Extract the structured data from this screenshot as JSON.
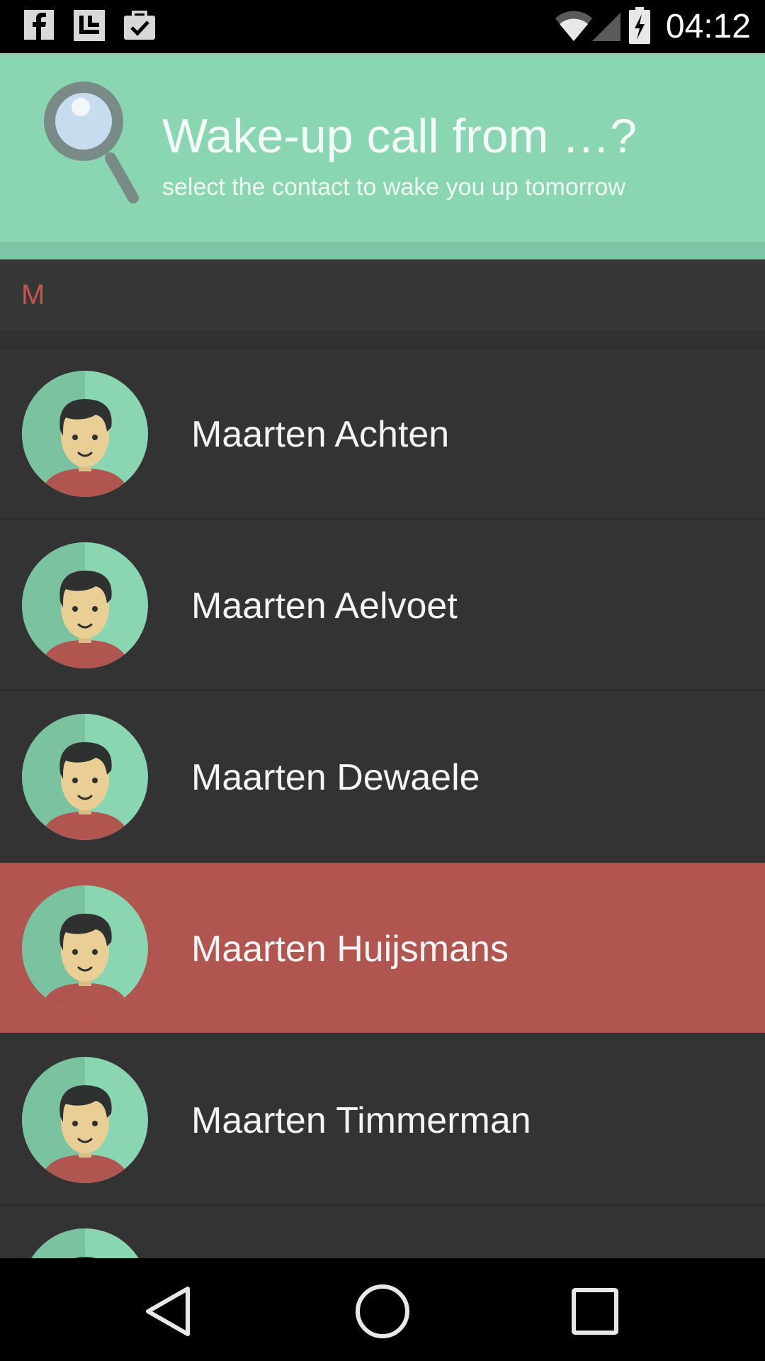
{
  "status_bar": {
    "time": "04:12",
    "notification_icons": [
      "facebook-icon",
      "linkedin-icon",
      "briefcase-check-icon"
    ],
    "system_icons": [
      "wifi-icon",
      "signal-icon",
      "battery-charging-icon"
    ]
  },
  "header": {
    "icon": "magnifier-icon",
    "title": "Wake-up call from …?",
    "subtitle": "select the contact to wake you up tomorrow"
  },
  "section": {
    "letter": "M"
  },
  "contacts": [
    {
      "name": "Maarten Achten",
      "selected": false
    },
    {
      "name": "Maarten Aelvoet",
      "selected": false
    },
    {
      "name": "Maarten Dewaele",
      "selected": false
    },
    {
      "name": "Maarten Huijsmans",
      "selected": true
    },
    {
      "name": "Maarten Timmerman",
      "selected": false
    },
    {
      "name": "",
      "selected": false
    }
  ],
  "nav_bar": {
    "buttons": [
      "back-icon",
      "home-icon",
      "recents-icon"
    ]
  },
  "colors": {
    "header_bg": "#8ad6b3",
    "list_bg": "#333333",
    "selected_bg": "#b0554f",
    "section_letter": "#c4554e"
  }
}
